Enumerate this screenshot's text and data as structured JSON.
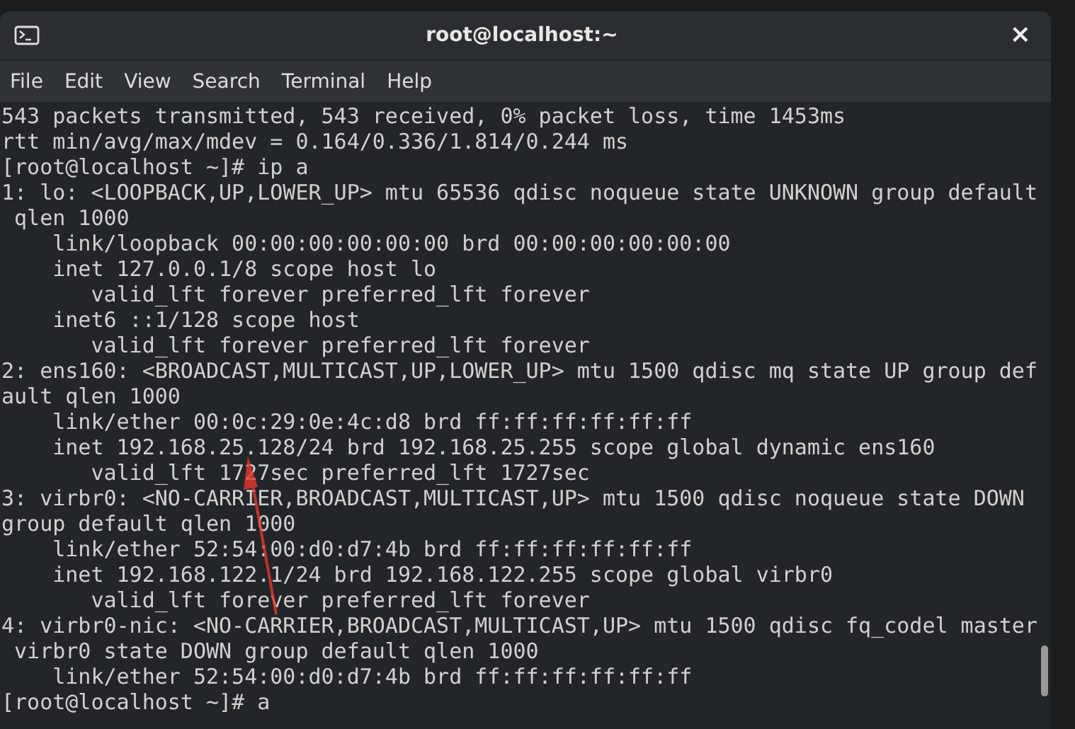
{
  "window": {
    "title": "root@localhost:~",
    "close": "×"
  },
  "menu": [
    {
      "label": "File"
    },
    {
      "label": "Edit"
    },
    {
      "label": "View"
    },
    {
      "label": "Search"
    },
    {
      "label": "Terminal"
    },
    {
      "label": "Help"
    }
  ],
  "terminal": {
    "lines": [
      "543 packets transmitted, 543 received, 0% packet loss, time 1453ms",
      "rtt min/avg/max/mdev = 0.164/0.336/1.814/0.244 ms",
      "[root@localhost ~]# ip a",
      "1: lo: <LOOPBACK,UP,LOWER_UP> mtu 65536 qdisc noqueue state UNKNOWN group default",
      " qlen 1000",
      "    link/loopback 00:00:00:00:00:00 brd 00:00:00:00:00:00",
      "    inet 127.0.0.1/8 scope host lo",
      "       valid_lft forever preferred_lft forever",
      "    inet6 ::1/128 scope host",
      "       valid_lft forever preferred_lft forever",
      "2: ens160: <BROADCAST,MULTICAST,UP,LOWER_UP> mtu 1500 qdisc mq state UP group def",
      "ault qlen 1000",
      "    link/ether 00:0c:29:0e:4c:d8 brd ff:ff:ff:ff:ff:ff",
      "    inet 192.168.25.128/24 brd 192.168.25.255 scope global dynamic ens160",
      "       valid_lft 1727sec preferred_lft 1727sec",
      "3: virbr0: <NO-CARRIER,BROADCAST,MULTICAST,UP> mtu 1500 qdisc noqueue state DOWN",
      "group default qlen 1000",
      "    link/ether 52:54:00:d0:d7:4b brd ff:ff:ff:ff:ff:ff",
      "    inet 192.168.122.1/24 brd 192.168.122.255 scope global virbr0",
      "       valid_lft forever preferred_lft forever",
      "4: virbr0-nic: <NO-CARRIER,BROADCAST,MULTICAST,UP> mtu 1500 qdisc fq_codel master",
      " virbr0 state DOWN group default qlen 1000",
      "    link/ether 52:54:00:d0:d7:4b brd ff:ff:ff:ff:ff:ff",
      "[root@localhost ~]# a"
    ]
  }
}
